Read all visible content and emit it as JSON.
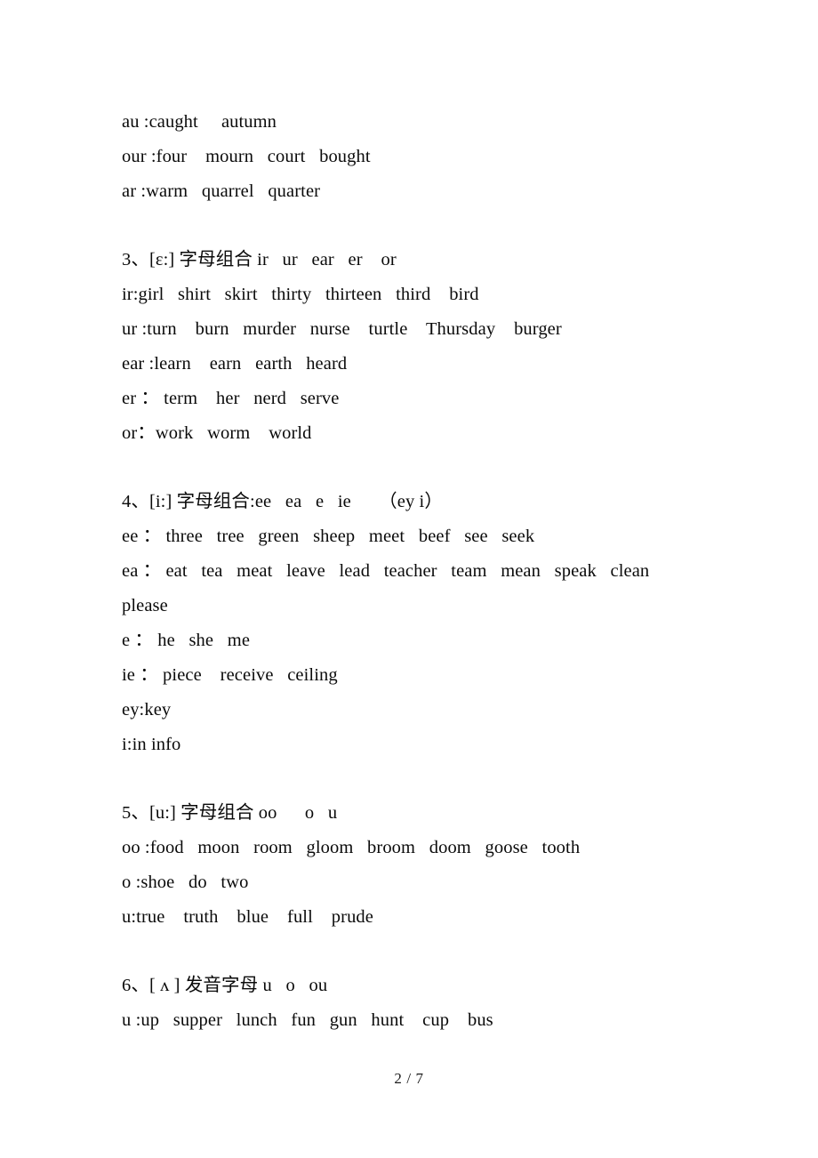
{
  "document": {
    "page_label": "2 / 7",
    "page_number": "2",
    "total_pages": "7"
  },
  "intro_lines": [
    "au :caught     autumn",
    "our :four    mourn   court   bought",
    "ar :warm   quarrel   quarter"
  ],
  "sections": [
    {
      "id": "section-3",
      "heading": "3、[ε:] 字母组合 ir   ur   ear   er    or",
      "number": "3",
      "phoneme": "[ε:]",
      "chinese_label": "字母组合",
      "letter_groups": "ir   ur   ear   er    or",
      "lines": [
        "ir:girl   shirt   skirt   thirty   thirteen   third    bird",
        "ur :turn    burn   murder   nurse    turtle    Thursday    burger",
        "ear :learn    earn   earth   heard",
        "er ： term    her   nerd   serve",
        "or：work   worm    world"
      ]
    },
    {
      "id": "section-4",
      "heading": "4、[i:] 字母组合:ee   ea   e   ie      （ey i）",
      "number": "4",
      "phoneme": "[i:]",
      "chinese_label": "字母组合",
      "letter_groups": "ee   ea   e   ie      （ey i）",
      "lines": [
        "ee ： three   tree   green   sheep   meet   beef   see   seek",
        "ea ： eat   tea   meat   leave   lead   teacher   team   mean   speak   clean",
        "please",
        "e ： he   she   me",
        "ie ： piece    receive   ceiling",
        "ey:key",
        "i:in info"
      ]
    },
    {
      "id": "section-5",
      "heading": "5、[u:] 字母组合 oo      o   u",
      "number": "5",
      "phoneme": "[u:]",
      "chinese_label": "字母组合",
      "letter_groups": "oo      o   u",
      "lines": [
        "oo :food   moon   room   gloom   broom   doom   goose   tooth",
        "o :shoe   do   two",
        "u:true    truth    blue    full    prude"
      ]
    },
    {
      "id": "section-6",
      "heading": "6、[ ʌ ] 发音字母 u   o   ou",
      "number": "6",
      "phoneme": "[ ʌ ]",
      "chinese_label": "发音字母",
      "letter_groups": "u   o   ou",
      "lines": [
        "u :up   supper   lunch   fun   gun   hunt    cup    bus"
      ]
    }
  ],
  "colors": {
    "background": "#ffffff",
    "text": "#0a0a0a",
    "footer_text": "#1a1a1a"
  }
}
